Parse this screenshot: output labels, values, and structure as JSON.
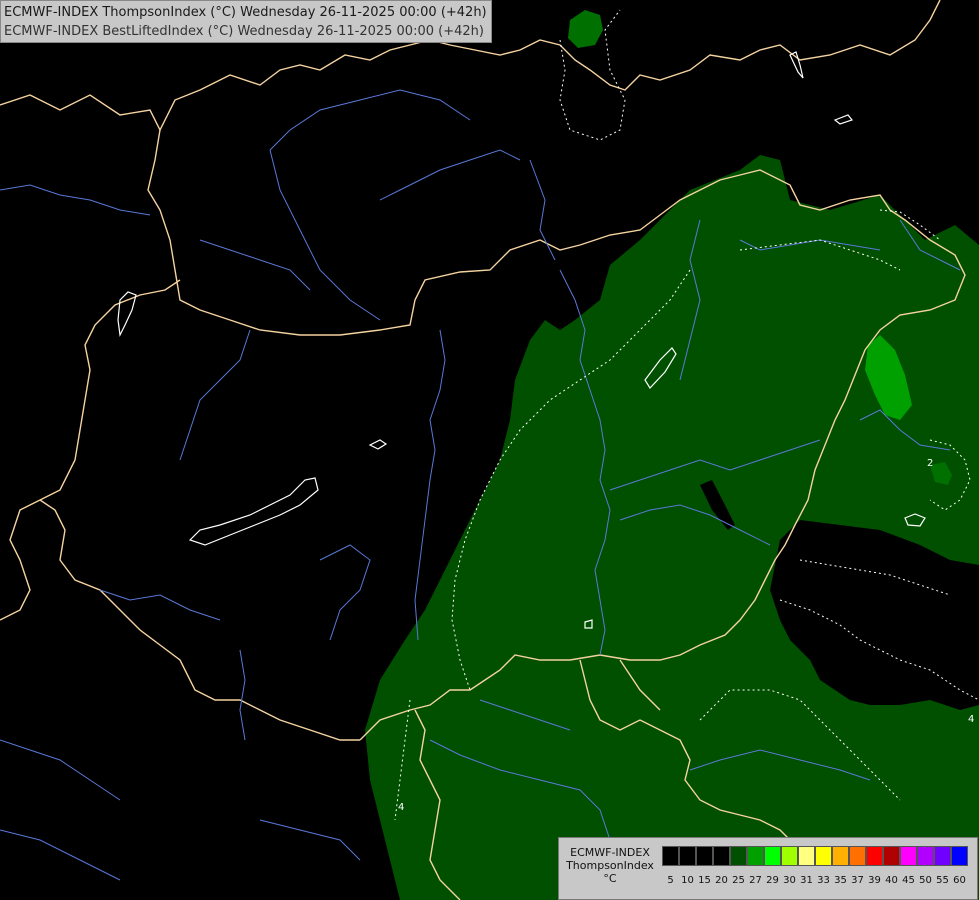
{
  "title": {
    "line1": "ECMWF-INDEX ThompsonIndex (°C) Wednesday 26-11-2025 00:00 (+42h)",
    "line2": "ECMWF-INDEX BestLiftedIndex (°C) Wednesday 26-11-2025 00:00 (+42h)"
  },
  "legend": {
    "model": "ECMWF-INDEX",
    "parameter": "ThompsonIndex",
    "unit": "°C",
    "ticks": [
      "5",
      "10",
      "15",
      "20",
      "25",
      "27",
      "29",
      "30",
      "31",
      "33",
      "35",
      "37",
      "39",
      "40",
      "45",
      "50",
      "55",
      "60"
    ],
    "colors": [
      "#000000",
      "#000000",
      "#000000",
      "#000000",
      "#005000",
      "#00a000",
      "#00ff00",
      "#a0ff00",
      "#ffff80",
      "#ffff00",
      "#ffb000",
      "#ff7000",
      "#ff0000",
      "#b00000",
      "#ff00ff",
      "#b000ff",
      "#7000ff",
      "#0000ff"
    ]
  },
  "contour_labels": [
    "2",
    "4",
    "4"
  ],
  "colors": {
    "background": "#000000",
    "fill_dark_green": "#005000",
    "fill_mid_green": "#009000",
    "border": "#f5d3a0",
    "river": "#5a78d8",
    "contour": "#ffffff"
  }
}
